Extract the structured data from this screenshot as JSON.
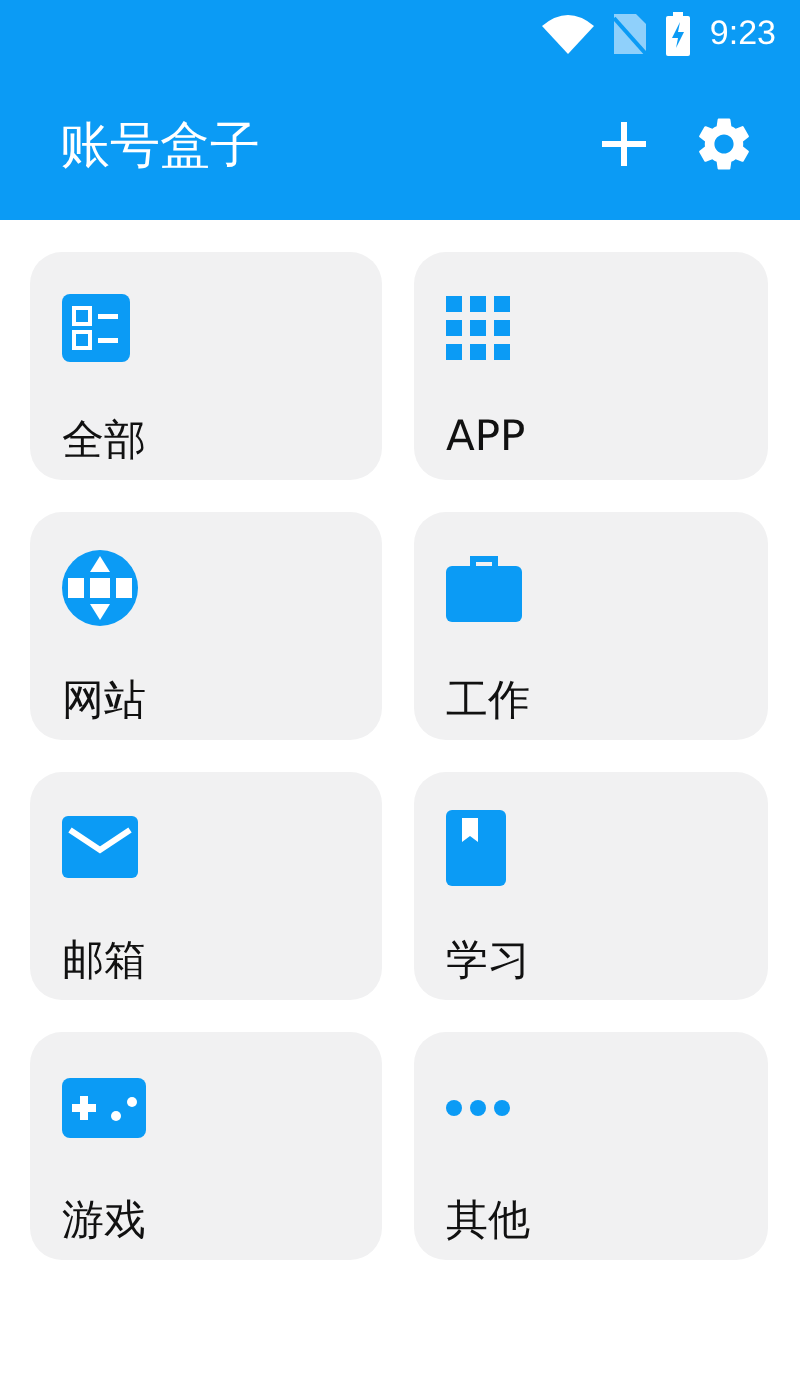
{
  "status_bar": {
    "time": "9:23"
  },
  "app_bar": {
    "title": "账号盒子"
  },
  "categories": [
    {
      "label": "全部"
    },
    {
      "label": "APP"
    },
    {
      "label": "网站"
    },
    {
      "label": "工作"
    },
    {
      "label": "邮箱"
    },
    {
      "label": "学习"
    },
    {
      "label": "游戏"
    },
    {
      "label": "其他"
    }
  ]
}
